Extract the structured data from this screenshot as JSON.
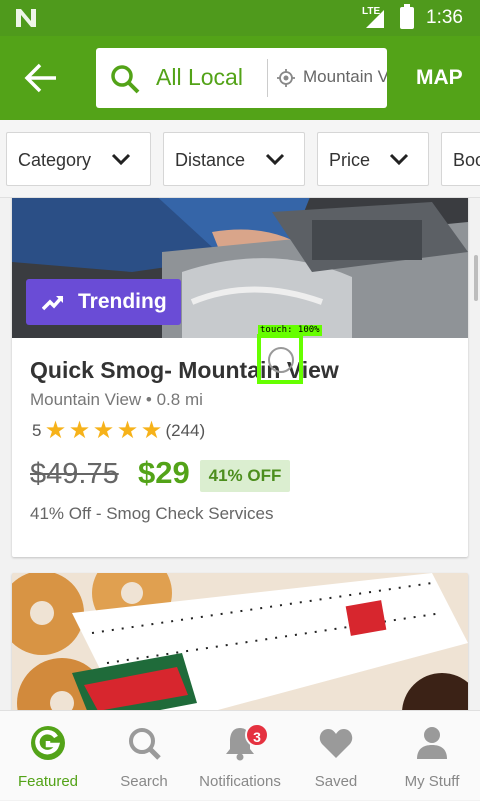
{
  "status_bar": {
    "network": "LTE",
    "time": "1:36"
  },
  "app_bar": {
    "search_query": "All Local",
    "location": "Mountain View",
    "map_label": "MAP"
  },
  "filters": [
    {
      "label": "Category"
    },
    {
      "label": "Distance"
    },
    {
      "label": "Price"
    },
    {
      "label": "Booking"
    }
  ],
  "deals": [
    {
      "badge": "Trending",
      "title": "Quick Smog- Mountain View",
      "location": "Mountain View • 0.8 mi",
      "rating": "5",
      "stars": 5,
      "review_count": "(244)",
      "original_price": "$49.75",
      "price": "$29",
      "discount": "41% OFF",
      "description": "41% Off - Smog Check Services"
    }
  ],
  "touch_indicator": {
    "label": "touch: 100%"
  },
  "bottom_nav": [
    {
      "label": "Featured",
      "icon": "groupon-g-icon",
      "active": true
    },
    {
      "label": "Search",
      "icon": "search-icon"
    },
    {
      "label": "Notifications",
      "icon": "bell-icon",
      "badge": "3"
    },
    {
      "label": "Saved",
      "icon": "heart-icon"
    },
    {
      "label": "My Stuff",
      "icon": "person-icon"
    }
  ],
  "colors": {
    "brand_green": "#53a318",
    "trending_purple": "#6a4cd6",
    "star": "#f6b21a",
    "badge_red": "#e53240"
  }
}
